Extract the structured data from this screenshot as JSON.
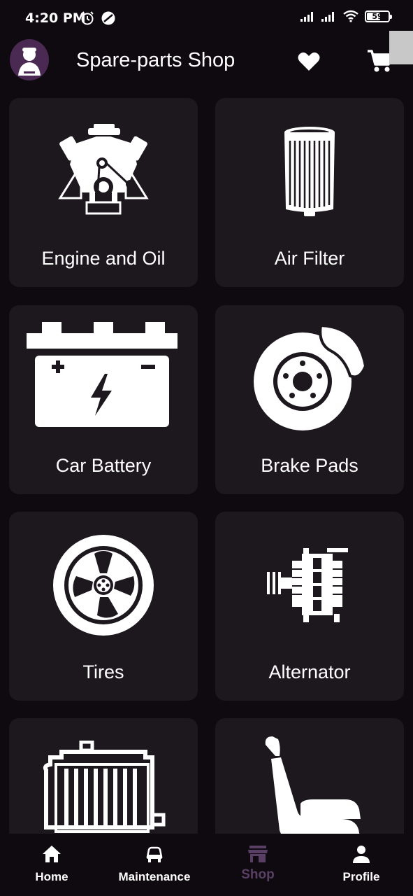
{
  "status_bar": {
    "time": "4:20 PM",
    "battery_level": "59",
    "icons": [
      "alarm-icon",
      "vpn-icon",
      "signal-icon",
      "signal-icon",
      "wifi-icon",
      "battery-icon"
    ]
  },
  "app_bar": {
    "title": "Spare-parts Shop",
    "avatar_icon": "mechanic-logo",
    "actions": [
      "heart-icon",
      "cart-icon"
    ]
  },
  "categories": [
    {
      "label": "Engine and Oil",
      "icon": "engine-icon"
    },
    {
      "label": "Air Filter",
      "icon": "air-filter-icon"
    },
    {
      "label": "Car Battery",
      "icon": "battery-icon"
    },
    {
      "label": "Brake Pads",
      "icon": "brake-disc-icon"
    },
    {
      "label": "Tires",
      "icon": "tire-icon"
    },
    {
      "label": "Alternator",
      "icon": "alternator-icon"
    },
    {
      "label": "",
      "icon": "radiator-icon"
    },
    {
      "label": "",
      "icon": "car-seat-icon"
    }
  ],
  "bottom_nav": {
    "items": [
      {
        "label": "Home",
        "icon": "home-icon"
      },
      {
        "label": "Maintenance",
        "icon": "car-maintenance-icon"
      },
      {
        "label": "Shop",
        "icon": "shop-icon",
        "active": true
      },
      {
        "label": "Profile",
        "icon": "profile-icon"
      }
    ]
  },
  "colors": {
    "background": "#0f0a0f",
    "card": "#1d171e",
    "avatar": "#4a2a52",
    "active_nav": "#5a3f64",
    "text": "#ffffff"
  }
}
